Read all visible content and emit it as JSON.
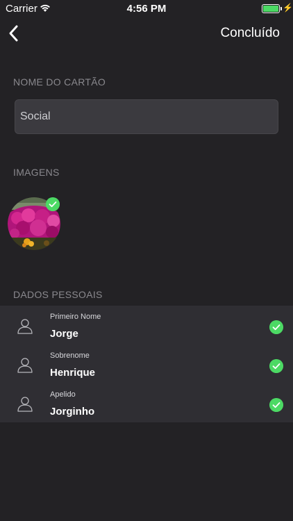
{
  "status_bar": {
    "carrier": "Carrier",
    "time": "4:56 PM",
    "battery_color": "#4cd964"
  },
  "nav": {
    "back_icon": "chevron-left-icon",
    "done_label": "Concluído"
  },
  "card_name": {
    "section_label": "NOME DO CARTÃO",
    "value": "Social"
  },
  "images": {
    "section_label": "IMAGENS",
    "items": [
      {
        "description_icon": "flower-photo",
        "selected": true
      }
    ]
  },
  "personal_data": {
    "section_label": "DADOS PESSOAIS",
    "rows": [
      {
        "label": "Primeiro Nome",
        "value": "Jorge",
        "selected": true
      },
      {
        "label": "Sobrenome",
        "value": "Henrique",
        "selected": true
      },
      {
        "label": "Apelido",
        "value": "Jorginho",
        "selected": true
      }
    ]
  },
  "colors": {
    "background": "#232225",
    "accent_check": "#4cd964",
    "section_label": "#8a898e"
  }
}
